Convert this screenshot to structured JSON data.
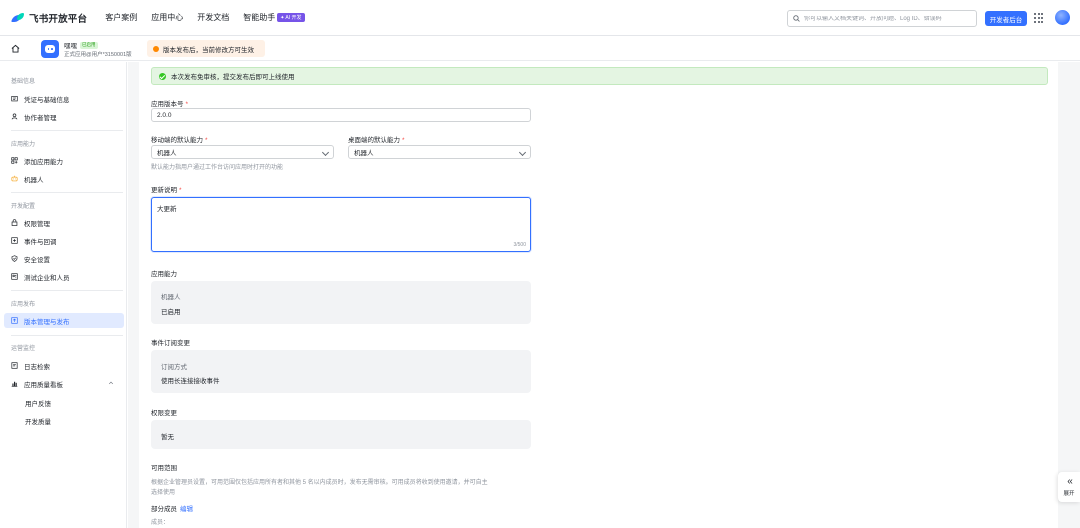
{
  "brand": {
    "logo_text": "飞书开放平台"
  },
  "nav": [
    {
      "label": "客户案例"
    },
    {
      "label": "应用中心"
    },
    {
      "label": "开发文档"
    },
    {
      "label": "智能助手",
      "badge": "AI 开发"
    }
  ],
  "search": {
    "placeholder": "你可以输入文档关键词、开放问题、Log ID、错误码"
  },
  "dev_console_button": "开发者后台",
  "app": {
    "name": "嘿嘿",
    "status": "已启用",
    "desc": "正式应用@用户*3150001版",
    "warning": "版本发布后，当前修改方可生效"
  },
  "sidebar": {
    "sections": [
      {
        "title": "基础信息",
        "items": [
          "凭证与基础信息",
          "协作者管理"
        ]
      },
      {
        "title": "应用能力",
        "items": [
          "添加应用能力",
          "机器人"
        ]
      },
      {
        "title": "开发配置",
        "items": [
          "权限管理",
          "事件与回调",
          "安全设置",
          "测试企业和人员"
        ]
      },
      {
        "title": "应用发布",
        "items": [
          "版本管理与发布"
        ]
      },
      {
        "title": "运营监控",
        "items": [
          "日志检索",
          "应用质量看板"
        ]
      }
    ],
    "subitems": [
      "用户反馈",
      "开发质量"
    ]
  },
  "form": {
    "success_notice": "本次发布免审核，提交发布后即可上线使用",
    "version_label": "应用版本号",
    "version_value": "2.0.0",
    "mobile_default_label": "移动端的默认能力",
    "mobile_default_value": "机器人",
    "desktop_default_label": "桌面端的默认能力",
    "desktop_default_value": "机器人",
    "default_hint": "默认能力指用户通过工作台访问应用时打开的功能",
    "update_label": "更新说明",
    "update_value": "大更新",
    "update_counter": "3/500",
    "capability_label": "应用能力",
    "capability_key": "机器人",
    "capability_value": "已启用",
    "event_label": "事件订阅变更",
    "event_key": "订阅方式",
    "event_value": "使用长连接接收事件",
    "permission_label": "权限变更",
    "permission_value": "暂无",
    "scope_label": "可用范围",
    "scope_desc_1": "根据企业管理员设置，可用范围仅包括应用所有者和其他 5 名以内成员时，发布无需审核。可用成员将收到使用邀请，并可自主",
    "scope_desc_2": "选择使用",
    "members_label": "部分成员",
    "members_edit": "编辑",
    "members_sub": "成员："
  },
  "expand_label": "展开",
  "colors": {
    "accent": "#3370ff",
    "success": "#34c724",
    "warning": "#ff8800",
    "required": "#f54a45"
  }
}
